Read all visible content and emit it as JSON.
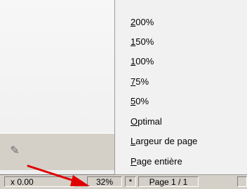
{
  "zoom_menu": {
    "items": [
      {
        "label": "200%",
        "mnemonic": "2",
        "rest": "00%"
      },
      {
        "label": "150%",
        "mnemonic": "1",
        "rest": "50%"
      },
      {
        "label": "100%",
        "mnemonic": "1",
        "rest": "00%"
      },
      {
        "label": "75%",
        "mnemonic": "7",
        "rest": "5%"
      },
      {
        "label": "50%",
        "mnemonic": "5",
        "rest": "0%"
      },
      {
        "label": "Optimal",
        "mnemonic": "O",
        "rest": "ptimal"
      },
      {
        "label": "Largeur de page",
        "mnemonic": "L",
        "rest": "argeur de page"
      },
      {
        "label": "Page entière",
        "mnemonic": "P",
        "rest": "age entière"
      }
    ]
  },
  "status_bar": {
    "coordinates": "x 0.00",
    "zoom": "32%",
    "modified_flag": "*",
    "page": "Page 1 / 1"
  },
  "colors": {
    "arrow": "#e00000",
    "menu_bg": "#f1f1f1",
    "chrome": "#d4d0c8"
  },
  "icons": {
    "toolbar": "tool-icon",
    "arrow": "red-arrow-icon"
  }
}
